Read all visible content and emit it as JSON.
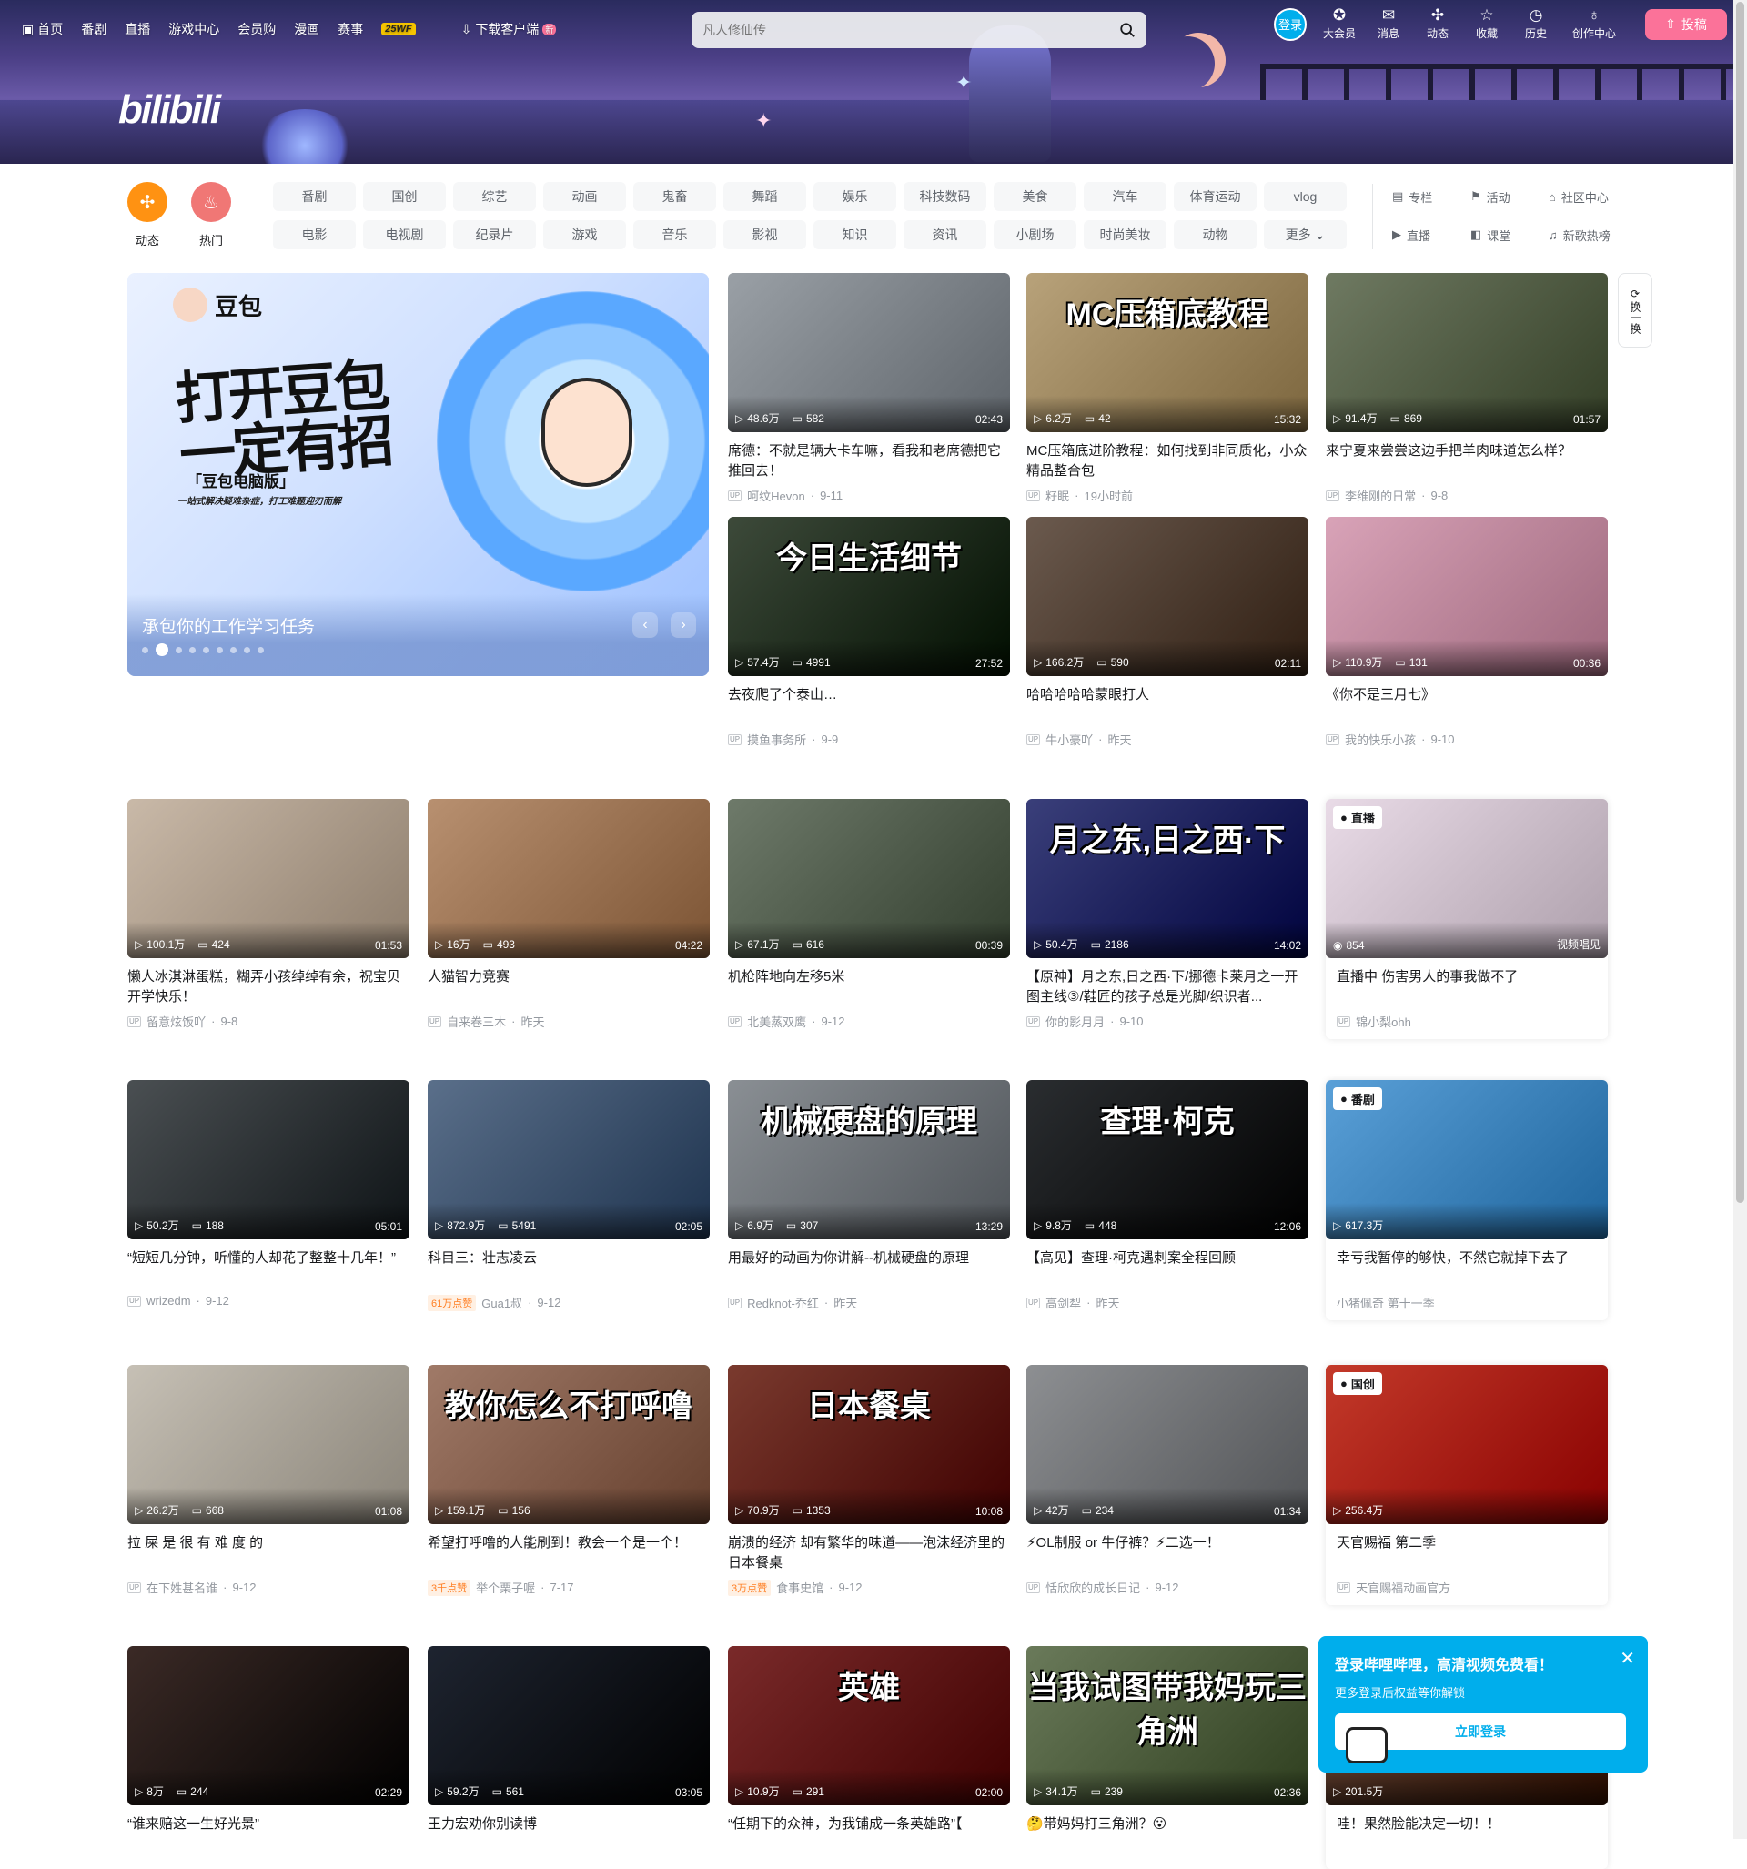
{
  "topnav": {
    "items": [
      "首页",
      "番剧",
      "直播",
      "游戏中心",
      "会员购",
      "漫画",
      "赛事"
    ],
    "badge": "25WF",
    "download": "下载客户端",
    "download_new": "新"
  },
  "search": {
    "placeholder": "凡人修仙传"
  },
  "right_nav": {
    "login": "登录",
    "items": [
      "大会员",
      "消息",
      "动态",
      "收藏",
      "历史",
      "创作中心"
    ],
    "upload": "投稿"
  },
  "brand": {
    "logo": "bilibili"
  },
  "channels": {
    "dynamic": "动态",
    "hot": "热门",
    "grid": [
      "番剧",
      "国创",
      "综艺",
      "动画",
      "鬼畜",
      "舞蹈",
      "娱乐",
      "科技数码",
      "美食",
      "汽车",
      "体育运动",
      "vlog",
      "电影",
      "电视剧",
      "纪录片",
      "游戏",
      "音乐",
      "影视",
      "知识",
      "资讯",
      "小剧场",
      "时尚美妆",
      "动物",
      "更多"
    ],
    "extra": [
      "专栏",
      "活动",
      "社区中心",
      "直播",
      "课堂",
      "新歌热榜"
    ]
  },
  "carousel": {
    "brand": "豆包",
    "slogan": "打开豆包 一定有招",
    "sub1": "「豆包电脑版」",
    "sub2": "一站式解决疑难杂症，打工难题迎刃而解",
    "caption": "承包你的工作学习任务"
  },
  "refresh": {
    "label": "换一换"
  },
  "videos": [
    {
      "views": "48.6万",
      "danmaku": "582",
      "duration": "02:43",
      "title": "席德：不就是辆大卡车嘛，看我和老席德把它推回去！",
      "author": "呵纹Hevon",
      "date": "9-11",
      "likes": "",
      "color": "#9aa0a6"
    },
    {
      "views": "6.2万",
      "danmaku": "42",
      "duration": "15:32",
      "title": "MC压箱底进阶教程：如何找到非同质化，小众精品整合包",
      "author": "籽眠",
      "date": "19小时前",
      "likes": "",
      "color": "#b8a27a",
      "overlay": "MC压箱底教程"
    },
    {
      "views": "91.4万",
      "danmaku": "869",
      "duration": "01:57",
      "title": "来宁夏来尝尝这边手把羊肉味道怎么样？",
      "author": "李维刚的日常",
      "date": "9-8",
      "likes": "",
      "color": "#6f7a62"
    },
    {
      "views": "57.4万",
      "danmaku": "4991",
      "duration": "27:52",
      "title": "去夜爬了个泰山…",
      "author": "摸鱼事务所",
      "date": "9-9",
      "likes": "",
      "color": "#3d4a3a",
      "overlay": "今日生活细节"
    },
    {
      "views": "166.2万",
      "danmaku": "590",
      "duration": "02:11",
      "title": "哈哈哈哈哈蒙眼打人",
      "author": "牛小豪吖",
      "date": "昨天",
      "likes": "",
      "color": "#6b5a4e"
    },
    {
      "views": "110.9万",
      "danmaku": "131",
      "duration": "00:36",
      "title": "《你不是三月七》",
      "author": "我的快乐小孩",
      "date": "9-10",
      "likes": "",
      "color": "#d9a3b8"
    },
    {
      "views": "100.1万",
      "danmaku": "424",
      "duration": "01:53",
      "title": "懒人冰淇淋蛋糕，糊弄小孩绰绰有余，祝宝贝开学快乐！",
      "author": "留意炫饭吖",
      "date": "9-8",
      "likes": "",
      "color": "#c9b9a8"
    },
    {
      "views": "16万",
      "danmaku": "493",
      "duration": "04:22",
      "title": "人猫智力竞赛",
      "author": "自来卷三木",
      "date": "昨天",
      "likes": "",
      "color": "#b89070"
    },
    {
      "views": "67.1万",
      "danmaku": "616",
      "duration": "00:39",
      "title": "机枪阵地向左移5米",
      "author": "北美蒸双鹰",
      "date": "9-12",
      "likes": "",
      "color": "#6e7a6a"
    },
    {
      "views": "50.4万",
      "danmaku": "2186",
      "duration": "14:02",
      "title": "【原神】月之东,日之西·下/挪德卡莱月之一开图主线③/鞋匠的孩子总是光脚/织识者...",
      "author": "你的影月月",
      "date": "9-10",
      "likes": "",
      "color": "#3a3f7a",
      "overlay": "月之东,日之西·下"
    },
    {
      "views": "50.2万",
      "danmaku": "188",
      "duration": "05:01",
      "title": "“短短几分钟，听懂的人却花了整整十几年！”",
      "author": "wrizedm",
      "date": "9-12",
      "likes": "",
      "color": "#4a4f52"
    },
    {
      "views": "872.9万",
      "danmaku": "5491",
      "duration": "02:05",
      "title": "科目三：壮志凌云",
      "author": "Gua1叔",
      "date": "9-12",
      "likes": "61万点赞",
      "color": "#5a6f8a"
    },
    {
      "views": "6.9万",
      "danmaku": "307",
      "duration": "13:29",
      "title": "用最好的动画为你讲解--机械硬盘的原理",
      "author": "Redknot-乔红",
      "date": "昨天",
      "likes": "",
      "color": "#8a8f94",
      "overlay": "机械硬盘的原理"
    },
    {
      "views": "9.8万",
      "danmaku": "448",
      "duration": "12:06",
      "title": "【高见】查理·柯克遇刺案全程回顾",
      "author": "高剑犁",
      "date": "昨天",
      "likes": "",
      "color": "#2a2d30",
      "overlay": "查理·柯克"
    },
    {
      "views": "26.2万",
      "danmaku": "668",
      "duration": "01:08",
      "title": "拉 屎 是 很 有 难 度 的",
      "author": "在下姓甚名谁",
      "date": "9-12",
      "likes": "",
      "color": "#c6c0b5"
    },
    {
      "views": "159.1万",
      "danmaku": "156",
      "duration": "",
      "title": "希望打呼噜的人能刷到！教会一个是一个！",
      "author": "举个栗子喔",
      "date": "7-17",
      "likes": "3千点赞",
      "color": "#a07a68",
      "overlay": "教你怎么不打呼噜"
    },
    {
      "views": "70.9万",
      "danmaku": "1353",
      "duration": "10:08",
      "title": "崩溃的经济 却有繁华的味道——泡沫经济里的日本餐桌",
      "author": "食事史馆",
      "date": "9-12",
      "likes": "3万点赞",
      "color": "#7a3a2e",
      "overlay": "日本餐桌"
    },
    {
      "views": "42万",
      "danmaku": "234",
      "duration": "01:34",
      "title": "⚡OL制服 or 牛仔裤？⚡二选一！",
      "author": "恬欣欣的成长日记",
      "date": "9-12",
      "likes": "",
      "color": "#8d8f92"
    },
    {
      "views": "8万",
      "danmaku": "244",
      "duration": "02:29",
      "title": "“谁来赔这一生好光景”",
      "author": "",
      "date": "",
      "likes": "",
      "color": "#3b2a26"
    },
    {
      "views": "59.2万",
      "danmaku": "561",
      "duration": "03:05",
      "title": "王力宏劝你别读博",
      "author": "",
      "date": "",
      "likes": "",
      "color": "#1e2430",
      "overlay": ""
    },
    {
      "views": "10.9万",
      "danmaku": "291",
      "duration": "02:00",
      "title": "“任期下的众神，为我铺成一条英雄路”【",
      "author": "",
      "date": "",
      "likes": "",
      "color": "#7a2a2a",
      "overlay": "英雄"
    },
    {
      "views": "34.1万",
      "danmaku": "239",
      "duration": "02:36",
      "title": "🤔带妈妈打三角洲？😮",
      "author": "",
      "date": "",
      "likes": "",
      "color": "#6a7a5a",
      "overlay": "当我试图带我妈玩三角洲"
    }
  ],
  "specials": [
    {
      "badge": "直播",
      "viewers": "854",
      "tag": "视频唱见",
      "title": "伤害男人的事我做不了",
      "live": "直播中",
      "author": "锦小梨ohh",
      "color": "#e9dbe7"
    },
    {
      "badge": "番剧",
      "views": "617.3万",
      "title": "幸亏我暂停的够快，不然它就掉下去了",
      "sub": "小猪佩奇 第十一季",
      "color": "#5aa0d8"
    },
    {
      "badge": "国创",
      "views": "256.4万",
      "title": "天官赐福 第二季",
      "author": "天官赐福动画官方",
      "color": "#c43a2a"
    },
    {
      "views": "201.5万",
      "title": "哇！果然脸能决定一切！！",
      "color": "#6a4a3a"
    }
  ],
  "popup": {
    "title": "登录哔哩哔哩，高清视频免费看！",
    "sub": "更多登录后权益等你解锁",
    "button": "立即登录"
  }
}
